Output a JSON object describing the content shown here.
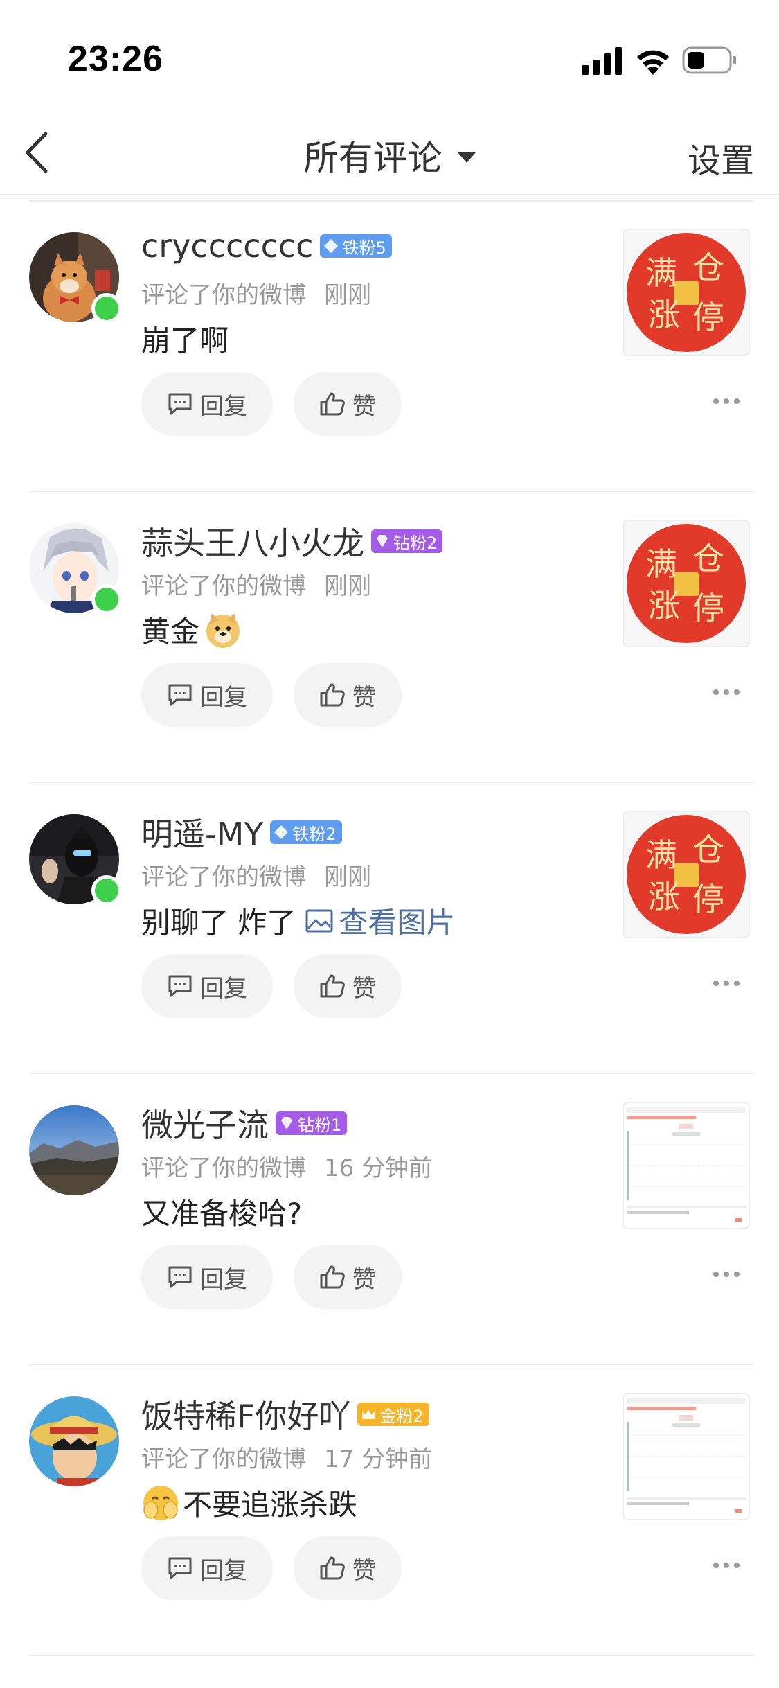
{
  "status_bar": {
    "time": "23:26"
  },
  "nav": {
    "title": "所有评论",
    "settings": "设置"
  },
  "actions": {
    "reply": "回复",
    "like": "赞"
  },
  "comments": [
    {
      "username": "cryccccccc",
      "badge": "铁粉5",
      "badge_color": "#5e9cf0",
      "action": "评论了你的微博",
      "time": "刚刚",
      "text": "崩了啊",
      "thumb_text": [
        "满",
        "仓",
        "涨",
        "停"
      ]
    },
    {
      "username": "蒜头王八小火龙",
      "badge": "钻粉2",
      "badge_color": "#a45ce8",
      "action": "评论了你的微博",
      "time": "刚刚",
      "text": "黄金",
      "thumb_text": [
        "满",
        "仓",
        "涨",
        "停"
      ]
    },
    {
      "username": "明遥-MY",
      "badge": "铁粉2",
      "badge_color": "#5e9cf0",
      "action": "评论了你的微博",
      "time": "刚刚",
      "text": "别聊了 炸了",
      "link": "查看图片",
      "thumb_text": [
        "满",
        "仓",
        "涨",
        "停"
      ]
    },
    {
      "username": "微光子流",
      "badge": "钻粉1",
      "badge_color": "#a45ce8",
      "action": "评论了你的微博",
      "time": "16 分钟前",
      "text": "又准备梭哈?"
    },
    {
      "username": "饭特稀F你好吖",
      "badge": "金粉2",
      "badge_color": "#f4b52a",
      "action": "评论了你的微博",
      "time": "17 分钟前",
      "text": "不要追涨杀跌"
    }
  ]
}
